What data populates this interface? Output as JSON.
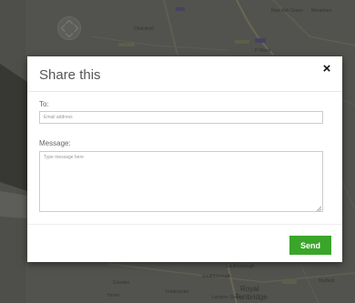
{
  "map": {
    "labels": {
      "chelsfield": "Chelsfield",
      "new_ash_green": "New Ash Green",
      "meopham": "Meopham",
      "south_borough": "Southborough",
      "southborough": "Southborough",
      "langton_green": "Langton Green",
      "royal_tunbridge": "Royal",
      "tunbridge": "Tunbridge",
      "matfield": "Matfield",
      "cowden": "Cowden",
      "fordcombe": "Fordcombe",
      "hever": "Hever",
      "road_badge": "A20",
      "pwm": "P Westi"
    }
  },
  "dialog": {
    "title": "Share this",
    "close_symbol": "×",
    "to_label": "To:",
    "email_placeholder": "Email address",
    "message_label": "Message:",
    "message_placeholder": "Type message here",
    "send_label": "Send"
  },
  "colors": {
    "send_button": "#3aa52a",
    "overlay": "#5f5f5b"
  }
}
